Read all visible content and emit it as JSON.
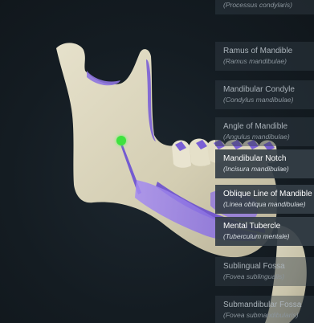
{
  "labels": [
    {
      "name": "",
      "latin": "(Processus condylaris)"
    },
    {
      "name": "Ramus of Mandible",
      "latin": "(Ramus mandibulae)"
    },
    {
      "name": "Mandibular Condyle",
      "latin": "(Condylus mandibulae)"
    },
    {
      "name": "Angle of Mandible",
      "latin": "(Angulus mandibulae)"
    },
    {
      "name": "Mandibular Notch",
      "latin": "(Incisura mandibulae)"
    },
    {
      "name": "Oblique Line of Mandible",
      "latin": "(Linea obliqua mandibulae)"
    },
    {
      "name": "Mental Tubercle",
      "latin": "(Tuberculum mentale)"
    },
    {
      "name": "Sublingual Fossa",
      "latin": "(Fovea sublingualis)"
    },
    {
      "name": "Submandibular Fossa",
      "latin": "(Fovea submandibularis)"
    }
  ],
  "colors": {
    "bone": "#ddd8c0",
    "highlight": "#8e74e0",
    "teeth_highlight": "#7a5fd6",
    "background": "#141c22",
    "cursor": "#3fe23f"
  },
  "icons": {
    "cursor": "cursor-dot"
  }
}
